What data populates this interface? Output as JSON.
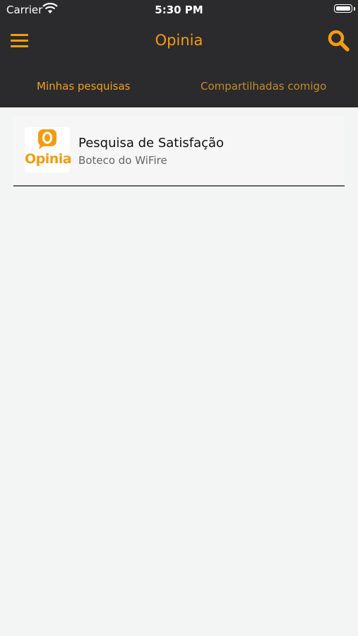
{
  "status_bar": {
    "carrier": "Carrier",
    "time": "5:30 PM"
  },
  "header": {
    "title": "Opinia",
    "accent_color": "#f39c12",
    "menu_icon": "hamburger-menu-icon",
    "search_icon": "search-icon"
  },
  "tabs": [
    {
      "label": "Minhas pesquisas",
      "selected": true
    },
    {
      "label": "Compartilhadas comigo",
      "selected": false
    }
  ],
  "surveys": [
    {
      "title": "Pesquisa de Satisfação",
      "subtitle": "Boteco do WiFire",
      "logo_text": "Opinia"
    }
  ]
}
